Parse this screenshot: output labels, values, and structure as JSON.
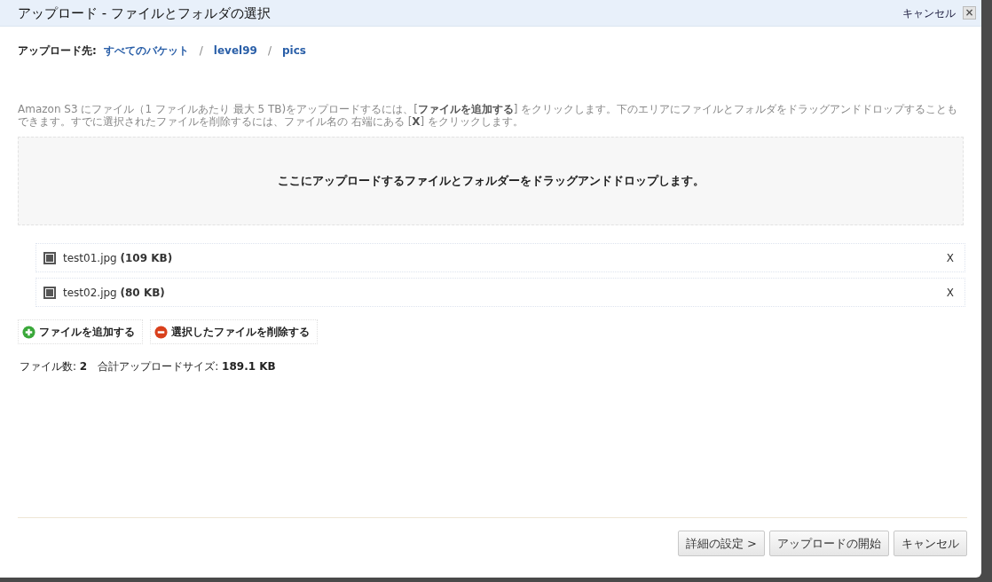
{
  "window": {
    "title": "アップロード - ファイルとフォルダの選択",
    "cancel_link": "キャンセル",
    "close_icon": "×"
  },
  "destination": {
    "label": "アップロード先:",
    "path": [
      {
        "text": "すべてのバケット"
      },
      {
        "text": "level99"
      },
      {
        "text": "pics"
      }
    ],
    "separator": "/"
  },
  "description": "Amazon S3 にファイル（1 ファイルあたり 最大 5 TB)をアップロードするには、[**ファイルを追加する**] をクリックします。下のエリアにファイルとフォルダをドラッグアンドドロップすることもできます。すでに選択されたファイルを削除するには、ファイル名の 右端にある [**X**] をクリックします。",
  "drop_zone": "ここにアップロードするファイルとフォルダーをドラッグアンドドロップします。",
  "files": [
    {
      "name": "test01.jpg **(109 KB)**",
      "remove": "X"
    },
    {
      "name": "test02.jpg **(80 KB)**",
      "remove": "X"
    }
  ],
  "actions": [
    {
      "kind": "add",
      "label": "ファイルを追加する"
    },
    {
      "kind": "remove",
      "label": "選択したファイルを削除する"
    }
  ],
  "summary": [
    "ファイル数: **2**",
    "合計アップロードサイズ: **189.1 KB**"
  ],
  "footer_buttons": [
    "詳細の設定 >",
    "アップロードの開始",
    "キャンセル"
  ]
}
